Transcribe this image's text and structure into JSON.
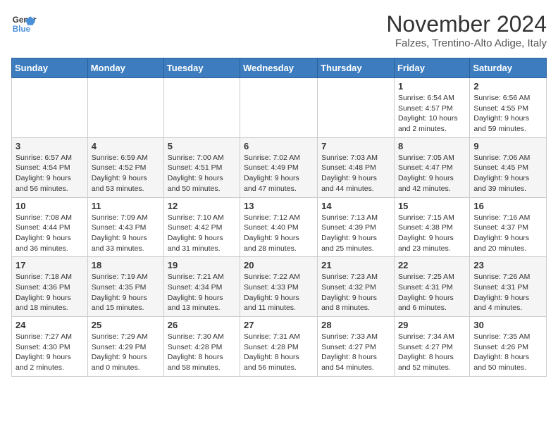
{
  "logo": {
    "line1": "General",
    "line2": "Blue"
  },
  "title": "November 2024",
  "location": "Falzes, Trentino-Alto Adige, Italy",
  "days_of_week": [
    "Sunday",
    "Monday",
    "Tuesday",
    "Wednesday",
    "Thursday",
    "Friday",
    "Saturday"
  ],
  "weeks": [
    [
      {
        "day": "",
        "info": ""
      },
      {
        "day": "",
        "info": ""
      },
      {
        "day": "",
        "info": ""
      },
      {
        "day": "",
        "info": ""
      },
      {
        "day": "",
        "info": ""
      },
      {
        "day": "1",
        "info": "Sunrise: 6:54 AM\nSunset: 4:57 PM\nDaylight: 10 hours and 2 minutes."
      },
      {
        "day": "2",
        "info": "Sunrise: 6:56 AM\nSunset: 4:55 PM\nDaylight: 9 hours and 59 minutes."
      }
    ],
    [
      {
        "day": "3",
        "info": "Sunrise: 6:57 AM\nSunset: 4:54 PM\nDaylight: 9 hours and 56 minutes."
      },
      {
        "day": "4",
        "info": "Sunrise: 6:59 AM\nSunset: 4:52 PM\nDaylight: 9 hours and 53 minutes."
      },
      {
        "day": "5",
        "info": "Sunrise: 7:00 AM\nSunset: 4:51 PM\nDaylight: 9 hours and 50 minutes."
      },
      {
        "day": "6",
        "info": "Sunrise: 7:02 AM\nSunset: 4:49 PM\nDaylight: 9 hours and 47 minutes."
      },
      {
        "day": "7",
        "info": "Sunrise: 7:03 AM\nSunset: 4:48 PM\nDaylight: 9 hours and 44 minutes."
      },
      {
        "day": "8",
        "info": "Sunrise: 7:05 AM\nSunset: 4:47 PM\nDaylight: 9 hours and 42 minutes."
      },
      {
        "day": "9",
        "info": "Sunrise: 7:06 AM\nSunset: 4:45 PM\nDaylight: 9 hours and 39 minutes."
      }
    ],
    [
      {
        "day": "10",
        "info": "Sunrise: 7:08 AM\nSunset: 4:44 PM\nDaylight: 9 hours and 36 minutes."
      },
      {
        "day": "11",
        "info": "Sunrise: 7:09 AM\nSunset: 4:43 PM\nDaylight: 9 hours and 33 minutes."
      },
      {
        "day": "12",
        "info": "Sunrise: 7:10 AM\nSunset: 4:42 PM\nDaylight: 9 hours and 31 minutes."
      },
      {
        "day": "13",
        "info": "Sunrise: 7:12 AM\nSunset: 4:40 PM\nDaylight: 9 hours and 28 minutes."
      },
      {
        "day": "14",
        "info": "Sunrise: 7:13 AM\nSunset: 4:39 PM\nDaylight: 9 hours and 25 minutes."
      },
      {
        "day": "15",
        "info": "Sunrise: 7:15 AM\nSunset: 4:38 PM\nDaylight: 9 hours and 23 minutes."
      },
      {
        "day": "16",
        "info": "Sunrise: 7:16 AM\nSunset: 4:37 PM\nDaylight: 9 hours and 20 minutes."
      }
    ],
    [
      {
        "day": "17",
        "info": "Sunrise: 7:18 AM\nSunset: 4:36 PM\nDaylight: 9 hours and 18 minutes."
      },
      {
        "day": "18",
        "info": "Sunrise: 7:19 AM\nSunset: 4:35 PM\nDaylight: 9 hours and 15 minutes."
      },
      {
        "day": "19",
        "info": "Sunrise: 7:21 AM\nSunset: 4:34 PM\nDaylight: 9 hours and 13 minutes."
      },
      {
        "day": "20",
        "info": "Sunrise: 7:22 AM\nSunset: 4:33 PM\nDaylight: 9 hours and 11 minutes."
      },
      {
        "day": "21",
        "info": "Sunrise: 7:23 AM\nSunset: 4:32 PM\nDaylight: 9 hours and 8 minutes."
      },
      {
        "day": "22",
        "info": "Sunrise: 7:25 AM\nSunset: 4:31 PM\nDaylight: 9 hours and 6 minutes."
      },
      {
        "day": "23",
        "info": "Sunrise: 7:26 AM\nSunset: 4:31 PM\nDaylight: 9 hours and 4 minutes."
      }
    ],
    [
      {
        "day": "24",
        "info": "Sunrise: 7:27 AM\nSunset: 4:30 PM\nDaylight: 9 hours and 2 minutes."
      },
      {
        "day": "25",
        "info": "Sunrise: 7:29 AM\nSunset: 4:29 PM\nDaylight: 9 hours and 0 minutes."
      },
      {
        "day": "26",
        "info": "Sunrise: 7:30 AM\nSunset: 4:28 PM\nDaylight: 8 hours and 58 minutes."
      },
      {
        "day": "27",
        "info": "Sunrise: 7:31 AM\nSunset: 4:28 PM\nDaylight: 8 hours and 56 minutes."
      },
      {
        "day": "28",
        "info": "Sunrise: 7:33 AM\nSunset: 4:27 PM\nDaylight: 8 hours and 54 minutes."
      },
      {
        "day": "29",
        "info": "Sunrise: 7:34 AM\nSunset: 4:27 PM\nDaylight: 8 hours and 52 minutes."
      },
      {
        "day": "30",
        "info": "Sunrise: 7:35 AM\nSunset: 4:26 PM\nDaylight: 8 hours and 50 minutes."
      }
    ]
  ]
}
